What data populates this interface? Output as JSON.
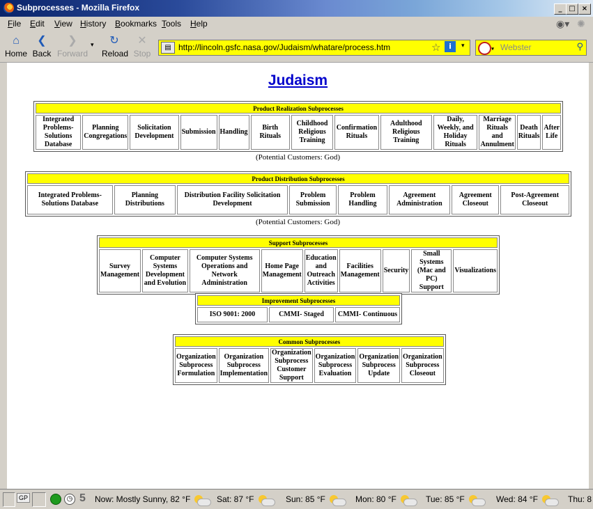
{
  "window": {
    "title": "Subprocesses - Mozilla Firefox"
  },
  "menu": [
    "File",
    "Edit",
    "View",
    "History",
    "Bookmarks",
    "Tools",
    "Help"
  ],
  "toolbar": {
    "home": "Home",
    "back": "Back",
    "forward": "Forward",
    "reload": "Reload",
    "stop": "Stop"
  },
  "address": {
    "url": "http://lincoln.gsfc.nasa.gov/Judaism/whatare/process.htm"
  },
  "search": {
    "placeholder": "Webster"
  },
  "page": {
    "title": "Judaism",
    "realization": {
      "header": "Product Realization Subprocesses",
      "cells": [
        "Integrated Problems-Solutions Database",
        "Planning Congregations",
        "Solicitation Development",
        "Submission",
        "Handling",
        "Birth Rituals",
        "Childhood Religious Training",
        "Confirmation Rituals",
        "Adulthood Religious Training",
        "Daily, Weekly, and Holiday Rituals",
        "Marriage Rituals and Annulment",
        "Death Rituals",
        "After Life"
      ],
      "caption": "(Potential Customers: God)"
    },
    "distribution": {
      "header": "Product Distribution Subprocesses",
      "cells": [
        "Integrated Problems-Solutions Database",
        "Planning Distributions",
        "Distribution Facility Solicitation Development",
        "Problem Submission",
        "Problem Handling",
        "Agreement Administration",
        "Agreement Closeout",
        "Post-Agreement Closeout"
      ],
      "caption": "(Potential Customers: God)"
    },
    "support": {
      "header": "Support Subprocesses",
      "cells": [
        "Survey Management",
        "Computer Systems Development and Evolution",
        "Computer Systems Operations and Network Administration",
        "Home Page Management",
        "Education and Outreach Activities",
        "Facilities Management",
        "Security",
        "Small Systems (Mac and PC) Support",
        "Visualizations"
      ]
    },
    "improvement": {
      "header": "Improvement Subprocesses",
      "cells": [
        "ISO 9001: 2000",
        "CMMI- Staged",
        "CMMI- Continuous"
      ]
    },
    "common": {
      "header": "Common Subprocesses",
      "cells": [
        "Organization Subprocess Formulation",
        "Organization Subprocess Implementation",
        "Organization Subprocess Customer Support",
        "Organization Subprocess Evaluation",
        "Organization Subprocess Update",
        "Organization Subprocess Closeout"
      ]
    }
  },
  "status": {
    "gp": "GP",
    "count": "5",
    "now": "Now: Mostly Sunny, 82 °F",
    "sat": "Sat: 87 °F",
    "sun": "Sun: 85 °F",
    "mon": "Mon: 80 °F",
    "tue": "Tue: 85 °F",
    "wed": "Wed: 84 °F",
    "thu": "Thu: 8"
  }
}
